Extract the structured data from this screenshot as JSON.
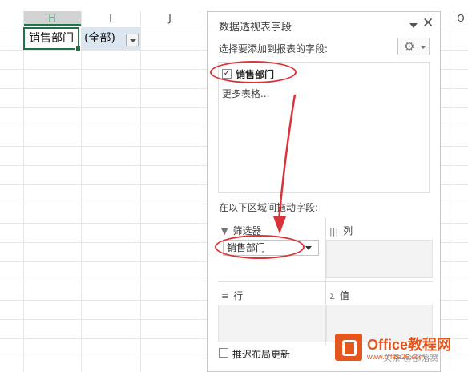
{
  "sheet": {
    "columns": [
      {
        "label": "H",
        "active": true
      },
      {
        "label": "I",
        "active": false
      },
      {
        "label": "J",
        "active": false
      },
      {
        "label": "O",
        "active": false
      }
    ],
    "cell_h1": "销售部门",
    "cell_i1": "(全部)"
  },
  "pane": {
    "title": "数据透视表字段",
    "close_label": "✕",
    "choose_label": "选择要添加到报表的字段:",
    "fields": [
      {
        "label": "销售部门",
        "checked": true,
        "check_glyph": "✓"
      }
    ],
    "more_tables": "更多表格...",
    "area_label": "在以下区域间拖动字段:",
    "zones": {
      "filters": {
        "title": "筛选器",
        "items": [
          "销售部门"
        ]
      },
      "columns": {
        "title": "列",
        "items": []
      },
      "rows": {
        "title": "行",
        "items": []
      },
      "values": {
        "title": "值",
        "items": []
      }
    },
    "defer_label": "推迟布局更新"
  },
  "watermark": {
    "brand": "Office教程网",
    "url": "www.office26.com",
    "sub": "头条 @部落窝"
  },
  "colors": {
    "accent": "#217346",
    "callout": "#d9343a",
    "brand": "#e4561d"
  }
}
